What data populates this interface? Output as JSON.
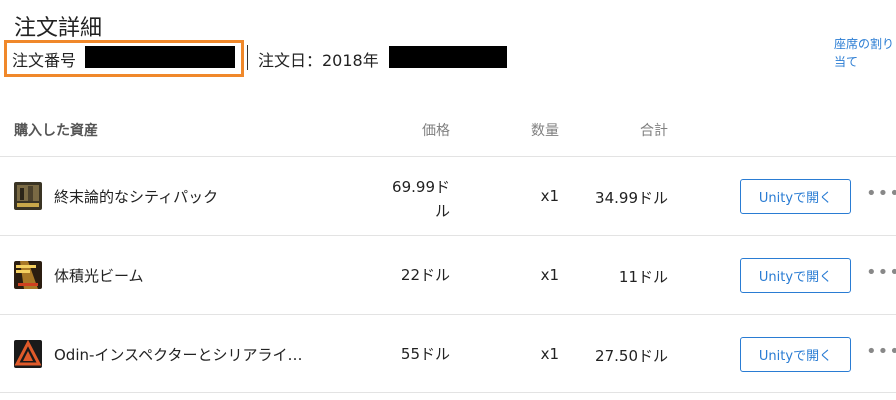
{
  "header": {
    "title": "注文詳細",
    "order_number_label": "注文番号",
    "order_date_label": "注文日：2018年",
    "seat_link": "座席の割り当て"
  },
  "table": {
    "columns": [
      "購入した資産",
      "価格",
      "数量",
      "合計"
    ],
    "rows": [
      {
        "name": "終末論的なシティパック",
        "price": "69.99ドル",
        "qty": "x1",
        "total": "34.99ドル",
        "button": "Unityで開く",
        "more": "•••",
        "icon": "city-pack-thumbnail"
      },
      {
        "name": "体積光ビーム",
        "price": "22ドル",
        "qty": "x1",
        "total": "11ドル",
        "button": "Unityで開く",
        "more": "•••",
        "icon": "volumetric-light-thumbnail"
      },
      {
        "name": "Odin-インスペクターとシリアライ…",
        "price": "55ドル",
        "qty": "x1",
        "total": "27.50ドル",
        "button": "Unityで開く",
        "more": "•••",
        "icon": "odin-logo"
      }
    ]
  },
  "colors": {
    "accent": "#2a7cd3",
    "highlight": "#f0882a"
  }
}
